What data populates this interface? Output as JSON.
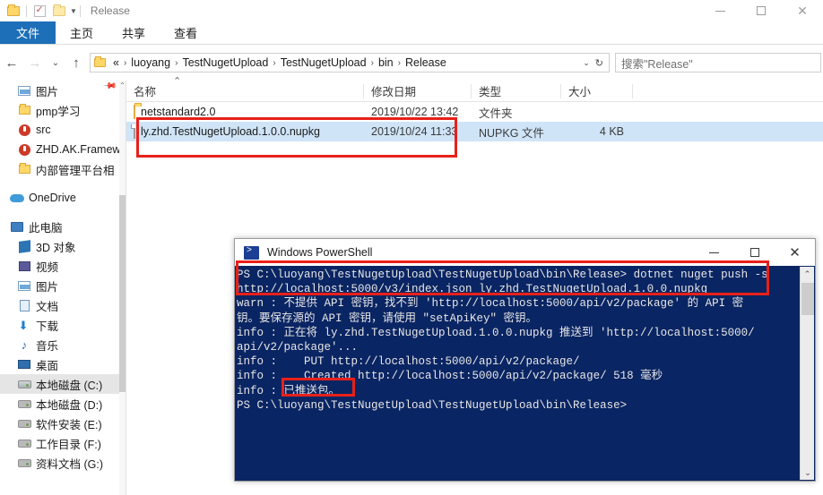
{
  "explorer": {
    "window_title": "Release",
    "quick_access": [
      "folder-icon",
      "properties-check-icon",
      "new-folder-icon",
      "customize-caret-icon"
    ],
    "window_buttons": [
      "minimize",
      "maximize",
      "close"
    ],
    "ribbon_tabs": [
      {
        "label": "文件",
        "active": true
      },
      {
        "label": "主页",
        "active": false
      },
      {
        "label": "共享",
        "active": false
      },
      {
        "label": "查看",
        "active": false
      }
    ],
    "address": {
      "back": "←",
      "forward": "→",
      "recent": "⌄",
      "up": "↑",
      "crumbs": [
        "«",
        "luoyang",
        "TestNugetUpload",
        "TestNugetUpload",
        "bin",
        "Release"
      ],
      "dropdown": "⌄",
      "refresh": "↻"
    },
    "search": {
      "placeholder": "搜索\"Release\"",
      "value": ""
    },
    "nav_pane": [
      {
        "label": "图片",
        "icon": "picture-icon",
        "pinned": true,
        "selected": false
      },
      {
        "label": "pmp学习",
        "icon": "folder-icon",
        "pinned": false,
        "selected": false
      },
      {
        "label": "src",
        "icon": "git-repo-icon",
        "pinned": false,
        "selected": false
      },
      {
        "label": "ZHD.AK.Framew",
        "icon": "git-repo-icon",
        "pinned": false,
        "selected": false
      },
      {
        "label": "内部管理平台相",
        "icon": "folder-icon",
        "pinned": false,
        "selected": false
      },
      {
        "label": "OneDrive",
        "icon": "onedrive-icon",
        "pinned": false,
        "selected": false,
        "group": true
      },
      {
        "label": "此电脑",
        "icon": "this-pc-icon",
        "pinned": false,
        "selected": false,
        "group": true
      },
      {
        "label": "3D 对象",
        "icon": "3d-objects-icon",
        "pinned": false,
        "selected": false
      },
      {
        "label": "视频",
        "icon": "videos-icon",
        "pinned": false,
        "selected": false
      },
      {
        "label": "图片",
        "icon": "pictures-icon",
        "pinned": false,
        "selected": false
      },
      {
        "label": "文档",
        "icon": "documents-icon",
        "pinned": false,
        "selected": false
      },
      {
        "label": "下载",
        "icon": "downloads-icon",
        "pinned": false,
        "selected": false
      },
      {
        "label": "音乐",
        "icon": "music-icon",
        "pinned": false,
        "selected": false
      },
      {
        "label": "桌面",
        "icon": "desktop-icon",
        "pinned": false,
        "selected": false
      },
      {
        "label": "本地磁盘 (C:)",
        "icon": "windows-drive-icon",
        "pinned": false,
        "selected": true
      },
      {
        "label": "本地磁盘 (D:)",
        "icon": "drive-icon",
        "pinned": false,
        "selected": false
      },
      {
        "label": "软件安装 (E:)",
        "icon": "drive-icon",
        "pinned": false,
        "selected": false
      },
      {
        "label": "工作目录 (F:)",
        "icon": "drive-icon",
        "pinned": false,
        "selected": false
      },
      {
        "label": "资料文档 (G:)",
        "icon": "drive-icon",
        "pinned": false,
        "selected": false
      }
    ],
    "columns": [
      {
        "label": "名称",
        "sorted": true
      },
      {
        "label": "修改日期",
        "sorted": false
      },
      {
        "label": "类型",
        "sorted": false
      },
      {
        "label": "大小",
        "sorted": false
      }
    ],
    "files": [
      {
        "name": "netstandard2.0",
        "date": "2019/10/22 13:42",
        "type": "文件夹",
        "size": "",
        "icon": "folder-icon",
        "selected": false
      },
      {
        "name": "ly.zhd.TestNugetUpload.1.0.0.nupkg",
        "date": "2019/10/24 11:33",
        "type": "NUPKG 文件",
        "size": "4 KB",
        "icon": "nupkg-file-icon",
        "selected": true
      }
    ]
  },
  "powershell": {
    "title": "Windows PowerShell",
    "window_buttons": [
      "minimize",
      "maximize",
      "close"
    ],
    "lines": [
      "PS C:\\luoyang\\TestNugetUpload\\TestNugetUpload\\bin\\Release> dotnet nuget push -s",
      "http://localhost:5000/v3/index.json ly.zhd.TestNugetUpload.1.0.0.nupkg",
      "warn : 不提供 API 密钥，找不到 'http://localhost:5000/api/v2/package' 的 API 密",
      "钥。要保存源的 API 密钥，请使用 \"setApiKey\" 密钥。",
      "info : 正在将 ly.zhd.TestNugetUpload.1.0.0.nupkg 推送到 'http://localhost:5000/",
      "api/v2/package'...",
      "info :    PUT http://localhost:5000/api/v2/package/",
      "info :    Created http://localhost:5000/api/v2/package/ 518 毫秒",
      "info : 已推送包。",
      "PS C:\\luoyang\\TestNugetUpload\\TestNugetUpload\\bin\\Release>"
    ],
    "scrollbar": {
      "up": "⌃",
      "down": "⌄"
    }
  },
  "annotations": {
    "color": "#e8201a",
    "boxes": [
      {
        "name": "selected-nupkg-file-highlight"
      },
      {
        "name": "push-command-highlight"
      },
      {
        "name": "package-pushed-highlight"
      }
    ]
  }
}
